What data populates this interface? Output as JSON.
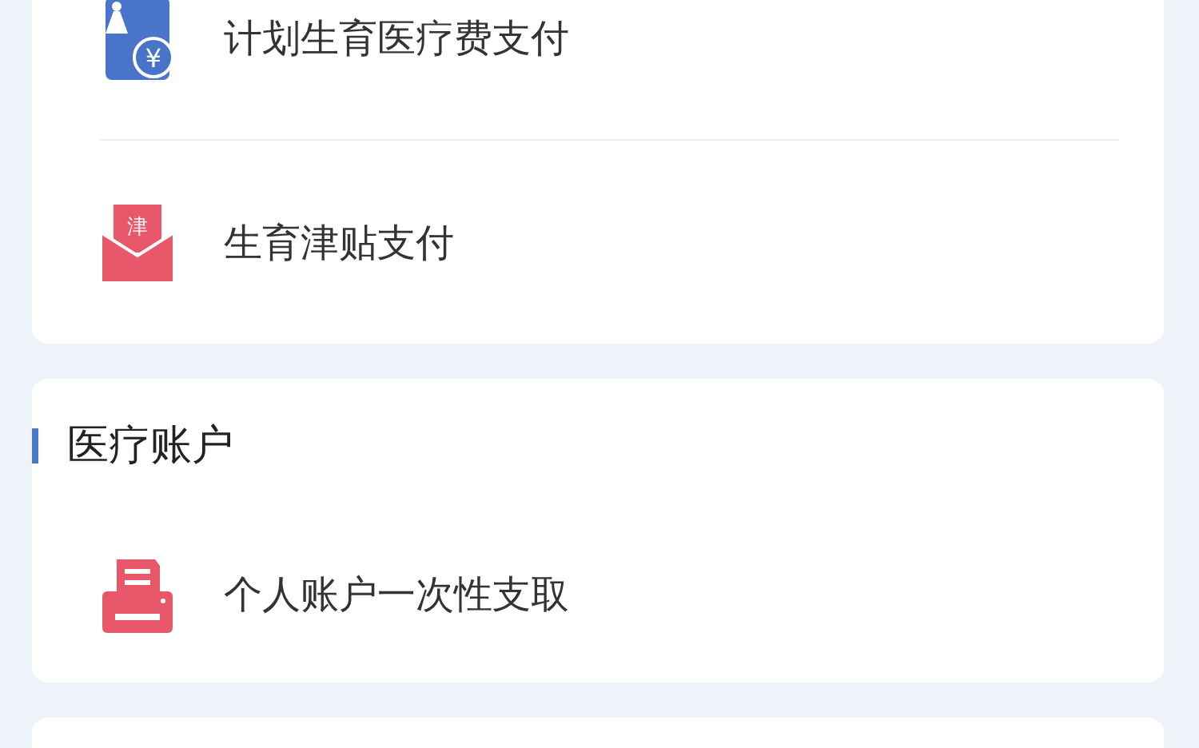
{
  "sections": [
    {
      "items": [
        {
          "kind": "maternity-fee",
          "icon_text": "¥",
          "label": "计划生育医疗费支付"
        },
        {
          "kind": "allowance",
          "icon_text": "津",
          "label": "生育津贴支付"
        }
      ]
    },
    {
      "heading": "医疗账户",
      "items": [
        {
          "kind": "printer",
          "label": "个人账户一次性支取"
        }
      ]
    }
  ]
}
